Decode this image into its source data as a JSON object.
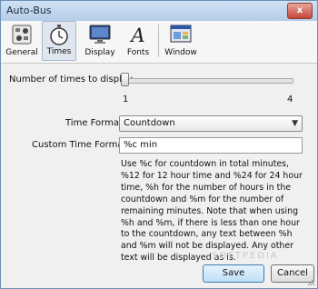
{
  "window": {
    "title": "Auto-Bus",
    "close_label": "x"
  },
  "toolbar": {
    "items": [
      {
        "label": "General",
        "icon": "general-icon"
      },
      {
        "label": "Times",
        "icon": "stopwatch-icon"
      },
      {
        "label": "Display",
        "icon": "monitor-icon"
      },
      {
        "label": "Fonts",
        "icon": "font-icon"
      },
      {
        "label": "Window",
        "icon": "window-icon"
      }
    ],
    "active": "Times"
  },
  "times": {
    "label": "Number of times to display",
    "min_label": "1",
    "max_label": "4",
    "value": 1
  },
  "time_format": {
    "label": "Time Format",
    "selected": "Countdown"
  },
  "custom_time_format": {
    "label": "Custom Time Format",
    "value": "%c min"
  },
  "help_text": "Use %c for countdown in total minutes, %12 for 12 hour time and %24 for 24 hour time, %h for the number of hours in the countdown and %m for the number of remaining minutes. Note that when using %h and %m, if there is less than one hour to the countdown, any text between %h and %m will not be displayed. Any other text will be displayed as is.",
  "buttons": {
    "save": "Save",
    "cancel": "Cancel"
  },
  "watermark": "SOFTPEDIA"
}
